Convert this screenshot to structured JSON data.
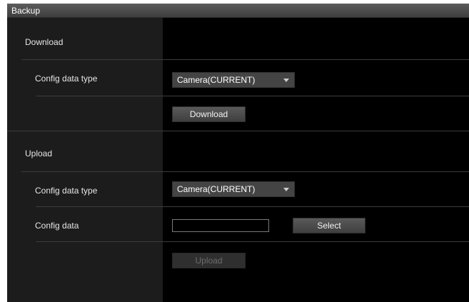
{
  "panel": {
    "title": "Backup"
  },
  "download": {
    "section_label": "Download",
    "config_type_label": "Config data type",
    "config_type_value": "Camera(CURRENT)",
    "button_label": "Download"
  },
  "upload": {
    "section_label": "Upload",
    "config_type_label": "Config data type",
    "config_type_value": "Camera(CURRENT)",
    "config_data_label": "Config data",
    "config_data_value": "",
    "select_button_label": "Select",
    "upload_button_label": "Upload",
    "upload_enabled": false
  },
  "icons": [
    "dropdown-arrow-icon"
  ]
}
